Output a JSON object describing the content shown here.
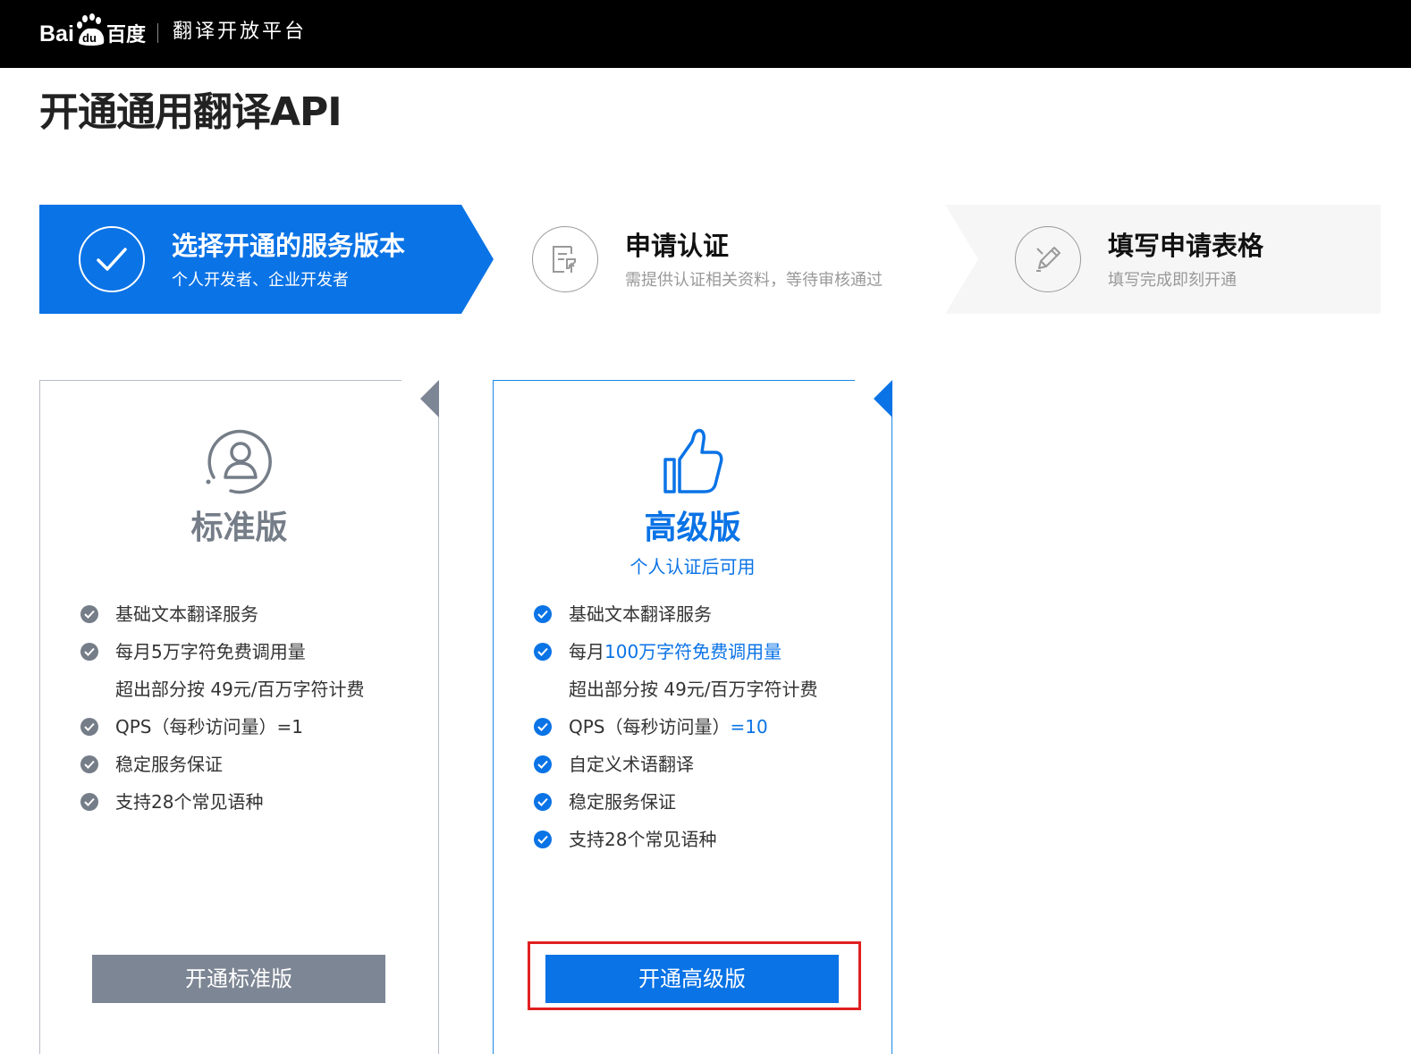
{
  "header": {
    "logo_text": "Bai du 百度",
    "platform_name": "翻译开放平台"
  },
  "page": {
    "title": "开通通用翻译API"
  },
  "steps": [
    {
      "title": "选择开通的服务版本",
      "subtitle": "个人开发者、企业开发者",
      "icon": "check-icon",
      "state": "active"
    },
    {
      "title": "申请认证",
      "subtitle": "需提供认证相关资料，等待审核通过",
      "icon": "document-upload-icon",
      "state": "pending"
    },
    {
      "title": "填写申请表格",
      "subtitle": "填写完成即刻开通",
      "icon": "pencil-icon",
      "state": "pending"
    }
  ],
  "plans": {
    "standard": {
      "name": "标准版",
      "icon": "user-icon",
      "features": {
        "f1": "基础文本翻译服务",
        "f2_pre": "每月",
        "f2_hl": "5万字符免费调用量",
        "f2_extra": "超出部分按 49元/百万字符计费",
        "f3_pre": "QPS（每秒访问量）",
        "f3_hl": "=1",
        "f4": "稳定服务保证",
        "f5": "支持28个常见语种"
      },
      "button_label": "开通标准版"
    },
    "advanced": {
      "name": "高级版",
      "note": "个人认证后可用",
      "icon": "thumbs-up-icon",
      "features": {
        "f1": "基础文本翻译服务",
        "f2_pre": "每月",
        "f2_hl": "100万字符免费调用量",
        "f2_extra": "超出部分按 49元/百万字符计费",
        "f3_pre": "QPS（每秒访问量）",
        "f3_hl": "=10",
        "f4": "自定义术语翻译",
        "f5": "稳定服务保证",
        "f6": "支持28个常见语种"
      },
      "button_label": "开通高级版"
    }
  },
  "colors": {
    "brand_blue": "#0a73e6",
    "standard_gray": "#7d8694",
    "highlight_red": "#e02020"
  }
}
